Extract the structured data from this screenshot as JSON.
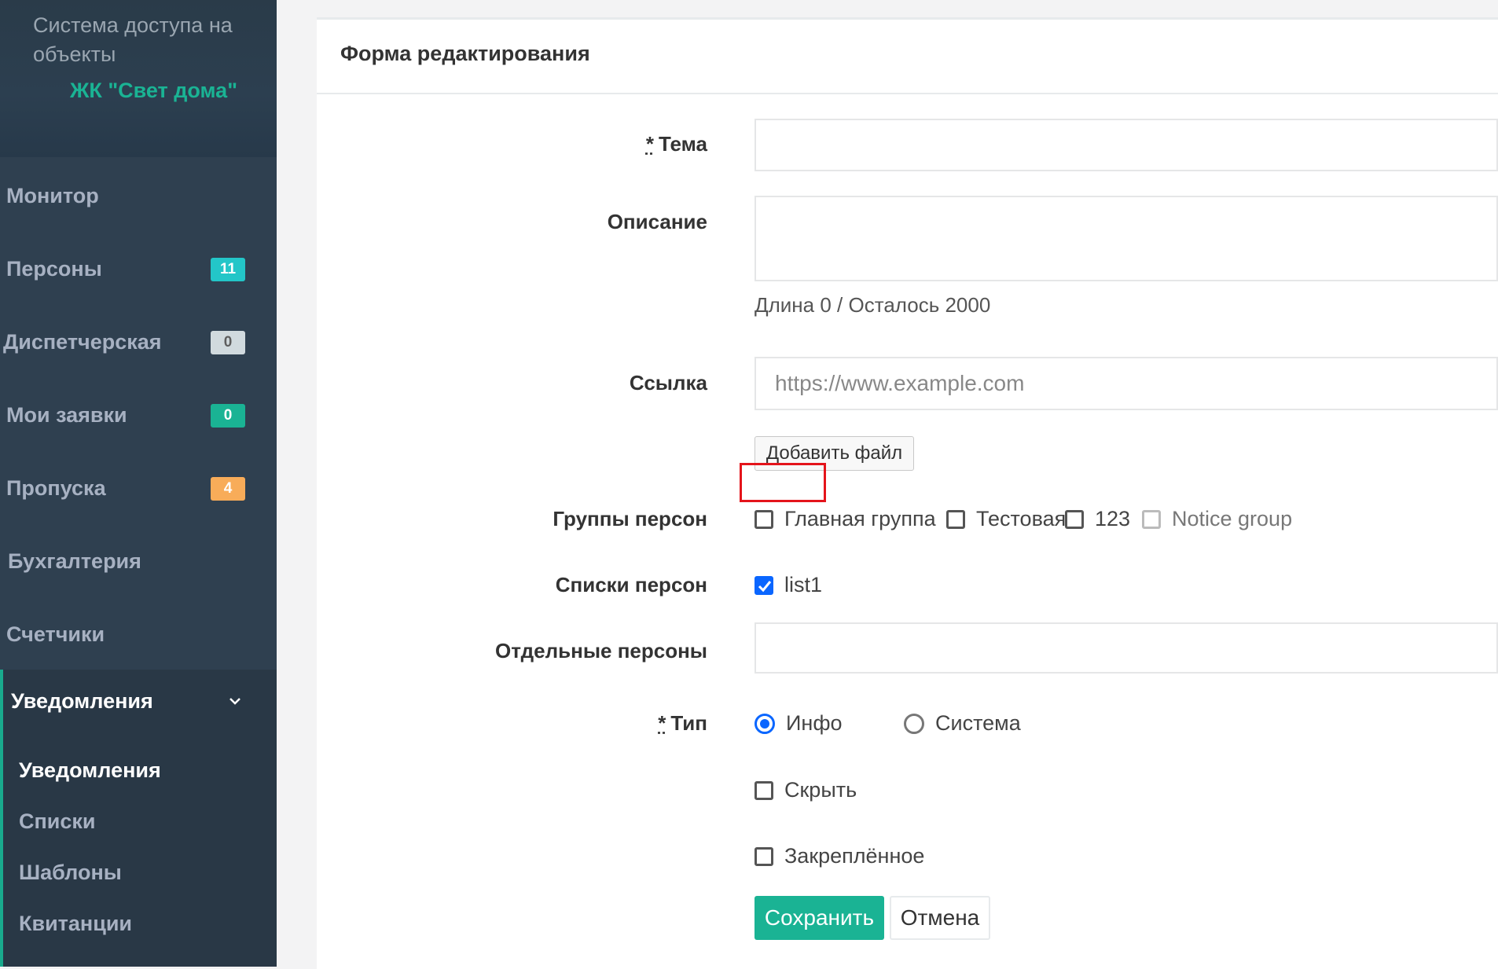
{
  "sidebar": {
    "system_title": "Система доступа на объекты",
    "complex_name": "ЖК \"Свет дома\"",
    "items": [
      {
        "label": "Монитор"
      },
      {
        "label": "Персоны",
        "badge": "11",
        "badge_color": "#23c6c8"
      },
      {
        "label": "Диспетчерская",
        "badge": "0",
        "badge_color": "#d1dade"
      },
      {
        "label": "Мои заявки",
        "badge": "0",
        "badge_color": "#1ab394"
      },
      {
        "label": "Пропуска",
        "badge": "4",
        "badge_color": "#f8ac59"
      },
      {
        "label": "Бухгалтерия"
      },
      {
        "label": "Счетчики"
      },
      {
        "label": "Уведомления",
        "icon": "chevron-down-icon"
      }
    ],
    "submenu": [
      {
        "label": "Уведомления"
      },
      {
        "label": "Списки"
      },
      {
        "label": "Шаблоны"
      },
      {
        "label": "Квитанции"
      }
    ]
  },
  "form": {
    "title": "Форма редактирования",
    "required_mark": "*",
    "topic_label": "Тема",
    "topic_value": "",
    "description_label": "Описание",
    "description_value": "",
    "description_help": "Длина 0 / Осталось 2000",
    "link_label": "Ссылка",
    "link_placeholder": "https://www.example.com",
    "add_file_label": "Добавить файл",
    "groups_label": "Группы персон",
    "groups": [
      {
        "label": "Главная группа",
        "checked": false
      },
      {
        "label": "Тестовая",
        "checked": false
      },
      {
        "label": "123",
        "checked": false
      },
      {
        "label": "Notice group",
        "checked": false,
        "disabled": true
      }
    ],
    "lists_label": "Списки персон",
    "lists": [
      {
        "label": "list1",
        "checked": true
      }
    ],
    "individuals_label": "Отдельные персоны",
    "individuals_value": "",
    "type_label": "Тип",
    "types": [
      {
        "label": "Инфо",
        "selected": true
      },
      {
        "label": "Система",
        "selected": false
      }
    ],
    "hide_label": "Скрыть",
    "hide_checked": false,
    "pinned_label": "Закреплённое",
    "pinned_checked": false,
    "save_label": "Сохранить",
    "cancel_label": "Отмена"
  },
  "colors": {
    "sidebar_bg": "#2f4050",
    "accent": "#1ab394",
    "checkbox_checked": "#0a66ff",
    "highlight": "#e4141b"
  }
}
